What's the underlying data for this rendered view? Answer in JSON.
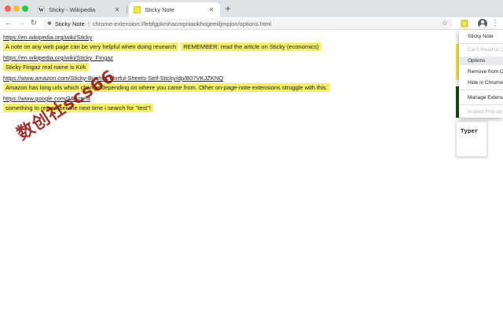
{
  "tabs": [
    {
      "title": "Sticky - Wikipedia",
      "favicon": "W"
    },
    {
      "title": "Sticky Note"
    }
  ],
  "toolbar": {
    "site_name": "Sticky Note",
    "url": "chrome-extension://lebfgpkmhacmpniaokhogeeiiljmpjon/options.html",
    "new_tab": "+",
    "back": "←",
    "forward": "→",
    "reload": "↻",
    "menu": "⋮",
    "star": "☆"
  },
  "entries": [
    {
      "url": "https://en.wikipedia.org/wiki/Sticky",
      "notes": [
        "A note on any web page can be very helpful when doing research",
        "REMEMBER: read the article on Sticky (economics)"
      ]
    },
    {
      "url": "https://en.wikipedia.org/wiki/Sticky_Fingaz",
      "notes": [
        "Sticky Fingaz real name is Kirk"
      ]
    },
    {
      "url": "https://www.amazon.com/Sticky-Bright-Colorful-Sheets-Self-Sticky/dp/B07VKJZKNQ",
      "notes": [
        "Amazon has long urls which change depending on where you came from. Other on-page-note-extensions struggle with this."
      ]
    },
    {
      "url": "https://www.google.com/?&q=test",
      "notes": [
        "something to remember the next time i search for \"test\"!"
      ]
    }
  ],
  "watermark": "数创社scs66",
  "typer_label": "Typer",
  "context_menu": {
    "items": [
      {
        "label": "Sticky Note",
        "disabled": false
      },
      {
        "label": "Can't Read or Change",
        "disabled": true
      },
      {
        "label": "Options",
        "disabled": false
      },
      {
        "label": "Remove from Chrome",
        "disabled": false
      },
      {
        "label": "Hide in Chrome Menu",
        "disabled": false
      },
      {
        "label": "Manage Extensions",
        "disabled": false
      },
      {
        "label": "Inspect Pop-up",
        "disabled": true
      }
    ]
  },
  "colors": {
    "note_yellow": "#f5f06a",
    "tab_strip": "#dee1e6",
    "watermark": "#8b1010"
  }
}
